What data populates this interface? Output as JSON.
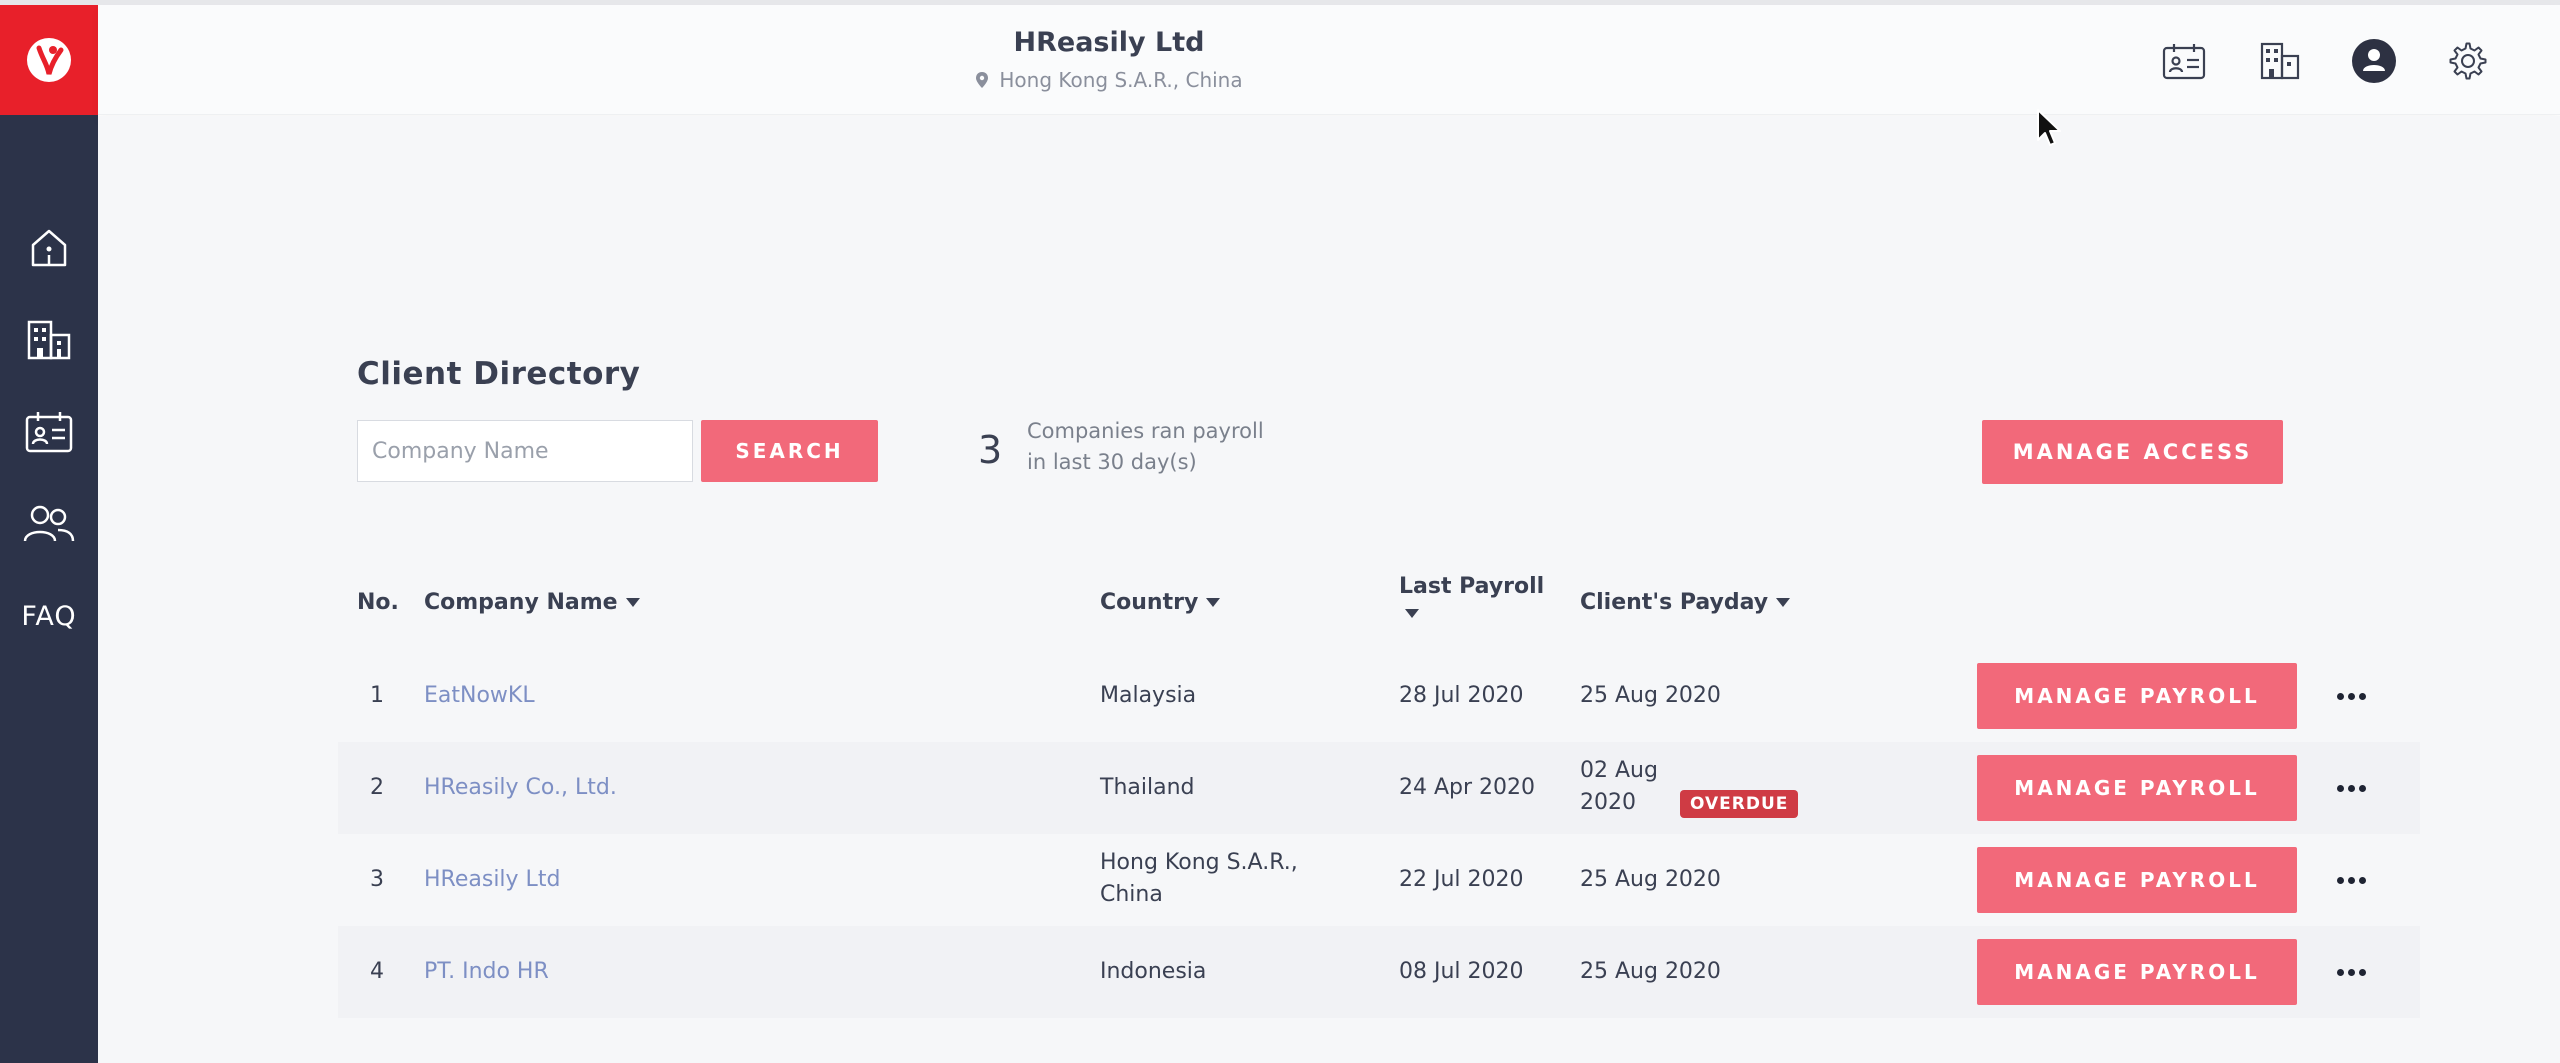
{
  "header": {
    "company_name": "HReasily Ltd",
    "location": "Hong Kong S.A.R., China"
  },
  "sidebar": {
    "items": [
      {
        "name": "home",
        "icon": "home-icon"
      },
      {
        "name": "companies",
        "icon": "building-icon"
      },
      {
        "name": "payroll-calendar",
        "icon": "id-card-calendar-icon"
      },
      {
        "name": "users",
        "icon": "users-icon"
      },
      {
        "name": "faq",
        "label": "FAQ"
      }
    ]
  },
  "header_icons": [
    "id-card-calendar-icon",
    "building-icon",
    "user-avatar-icon",
    "gear-icon"
  ],
  "main": {
    "title": "Client Directory",
    "search": {
      "placeholder": "Company Name",
      "value": "",
      "button_label": "SEARCH"
    },
    "stat": {
      "count": "3",
      "text_line1": "Companies ran payroll",
      "text_line2": "in last 30 day(s)"
    },
    "manage_access_label": "MANAGE ACCESS",
    "table": {
      "headers": {
        "no": "No.",
        "company": "Company Name",
        "country": "Country",
        "last_payroll": "Last Payroll",
        "payday": "Client's Payday"
      },
      "action_label": "MANAGE PAYROLL",
      "rows": [
        {
          "no": "1",
          "company": "EatNowKL",
          "country": "Malaysia",
          "country2": "",
          "last_payroll": "28 Jul 2020",
          "payday": "25 Aug 2020",
          "payday2": "",
          "badge": ""
        },
        {
          "no": "2",
          "company": "HReasily Co., Ltd.",
          "country": "Thailand",
          "country2": "",
          "last_payroll": "24 Apr 2020",
          "payday": "02 Aug",
          "payday2": "2020",
          "badge": "OVERDUE"
        },
        {
          "no": "3",
          "company": "HReasily Ltd",
          "country": "Hong Kong S.A.R.,",
          "country2": "China",
          "last_payroll": "22 Jul 2020",
          "payday": "25 Aug 2020",
          "payday2": "",
          "badge": ""
        },
        {
          "no": "4",
          "company": "PT. Indo HR",
          "country": "Indonesia",
          "country2": "",
          "last_payroll": "08 Jul 2020",
          "payday": "25 Aug 2020",
          "payday2": "",
          "badge": ""
        }
      ]
    }
  },
  "colors": {
    "sidebar": "#2c3349",
    "logo_bg": "#e8202a",
    "accent_pink": "#f2697a",
    "link_blue": "#7d8fc4",
    "overdue_red": "#cf3b44"
  }
}
